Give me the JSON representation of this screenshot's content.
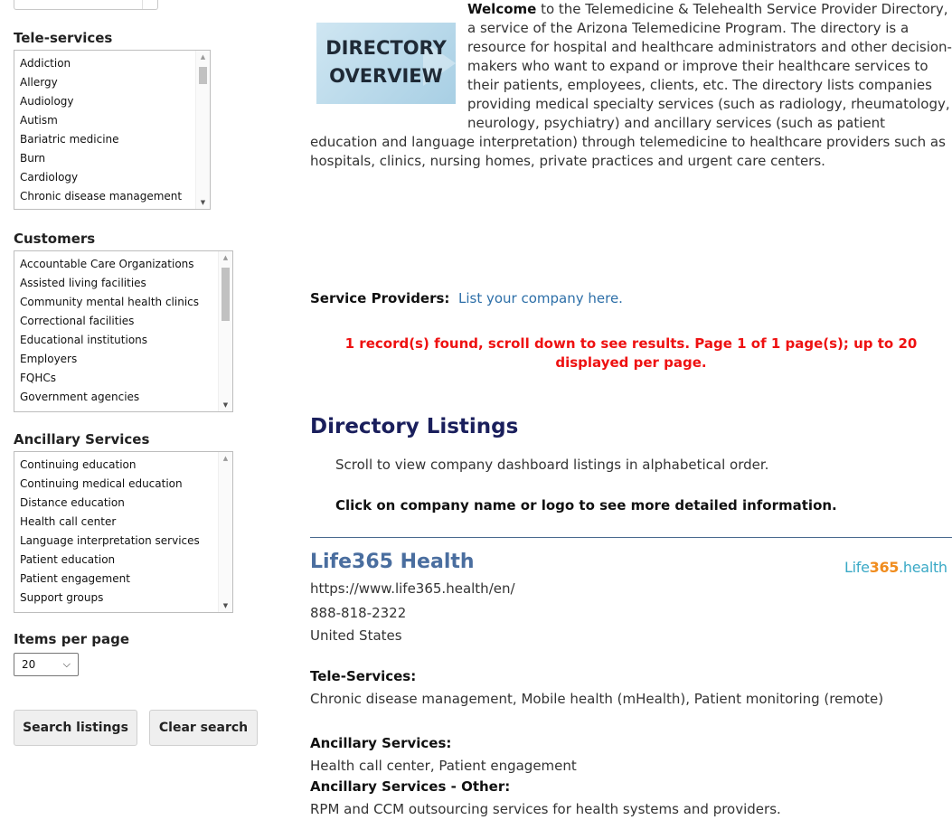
{
  "sidebar": {
    "teleservices": {
      "heading": "Tele-services",
      "items": [
        "Addiction",
        "Allergy",
        "Audiology",
        "Autism",
        "Bariatric medicine",
        "Burn",
        "Cardiology",
        "Chronic disease management"
      ]
    },
    "customers": {
      "heading": "Customers",
      "items": [
        "Accountable Care Organizations",
        "Assisted living facilities",
        "Community mental health clinics",
        "Correctional facilities",
        "Educational institutions",
        "Employers",
        "FQHCs",
        "Government agencies"
      ]
    },
    "ancillary": {
      "heading": "Ancillary Services",
      "items": [
        "Continuing education",
        "Continuing medical education",
        "Distance education",
        "Health call center",
        "Language interpretation services",
        "Patient education",
        "Patient engagement",
        "Support groups"
      ]
    },
    "items_per_page": {
      "label": "Items per page",
      "value": "20"
    },
    "search_button": "Search listings",
    "clear_button": "Clear search"
  },
  "main": {
    "overview_image": {
      "line1": "DIRECTORY",
      "line2": "OVERVIEW"
    },
    "intro_bold": "Welcome",
    "intro_text": " to the Telemedicine & Telehealth Service Provider Directory, a service of the Arizona Telemedicine Program. The directory is a resource for hospital and healthcare administrators and other decision-makers who want to expand or improve their healthcare services to their patients, employees, clients, etc. The directory lists companies providing medical specialty services (such as radiology, rheumatology, neurology, psychiatry) and ancillary services (such as patient education and language interpretation) through telemedicine to healthcare providers such as hospitals, clinics, nursing homes, private practices and urgent care centers.",
    "service_providers_label": "Service Providers:",
    "service_providers_link": "List your company here.",
    "records_message": "1 record(s) found, scroll down to see results. Page 1 of 1 page(s); up to 20 displayed per page.",
    "directory_title": "Directory Listings",
    "directory_sub": "Scroll to view company dashboard listings in alphabetical order.",
    "directory_click": "Click on company name or logo to see more detailed information."
  },
  "listing": {
    "name": "Life365 Health",
    "logo_part1": "Life",
    "logo_part2": "365",
    "logo_part3": ".health",
    "url": "https://www.life365.health/en/",
    "phone": "888-818-2322",
    "country": "United States",
    "teleservices_label": "Tele-Services:",
    "teleservices": "Chronic disease management, Mobile health (mHealth), Patient monitoring (remote)",
    "ancillary_label": "Ancillary Services:",
    "ancillary": "Health call center, Patient engagement",
    "ancillary_other_label": "Ancillary Services - Other:",
    "ancillary_other": "RPM and CCM outsourcing services for health systems and providers."
  }
}
